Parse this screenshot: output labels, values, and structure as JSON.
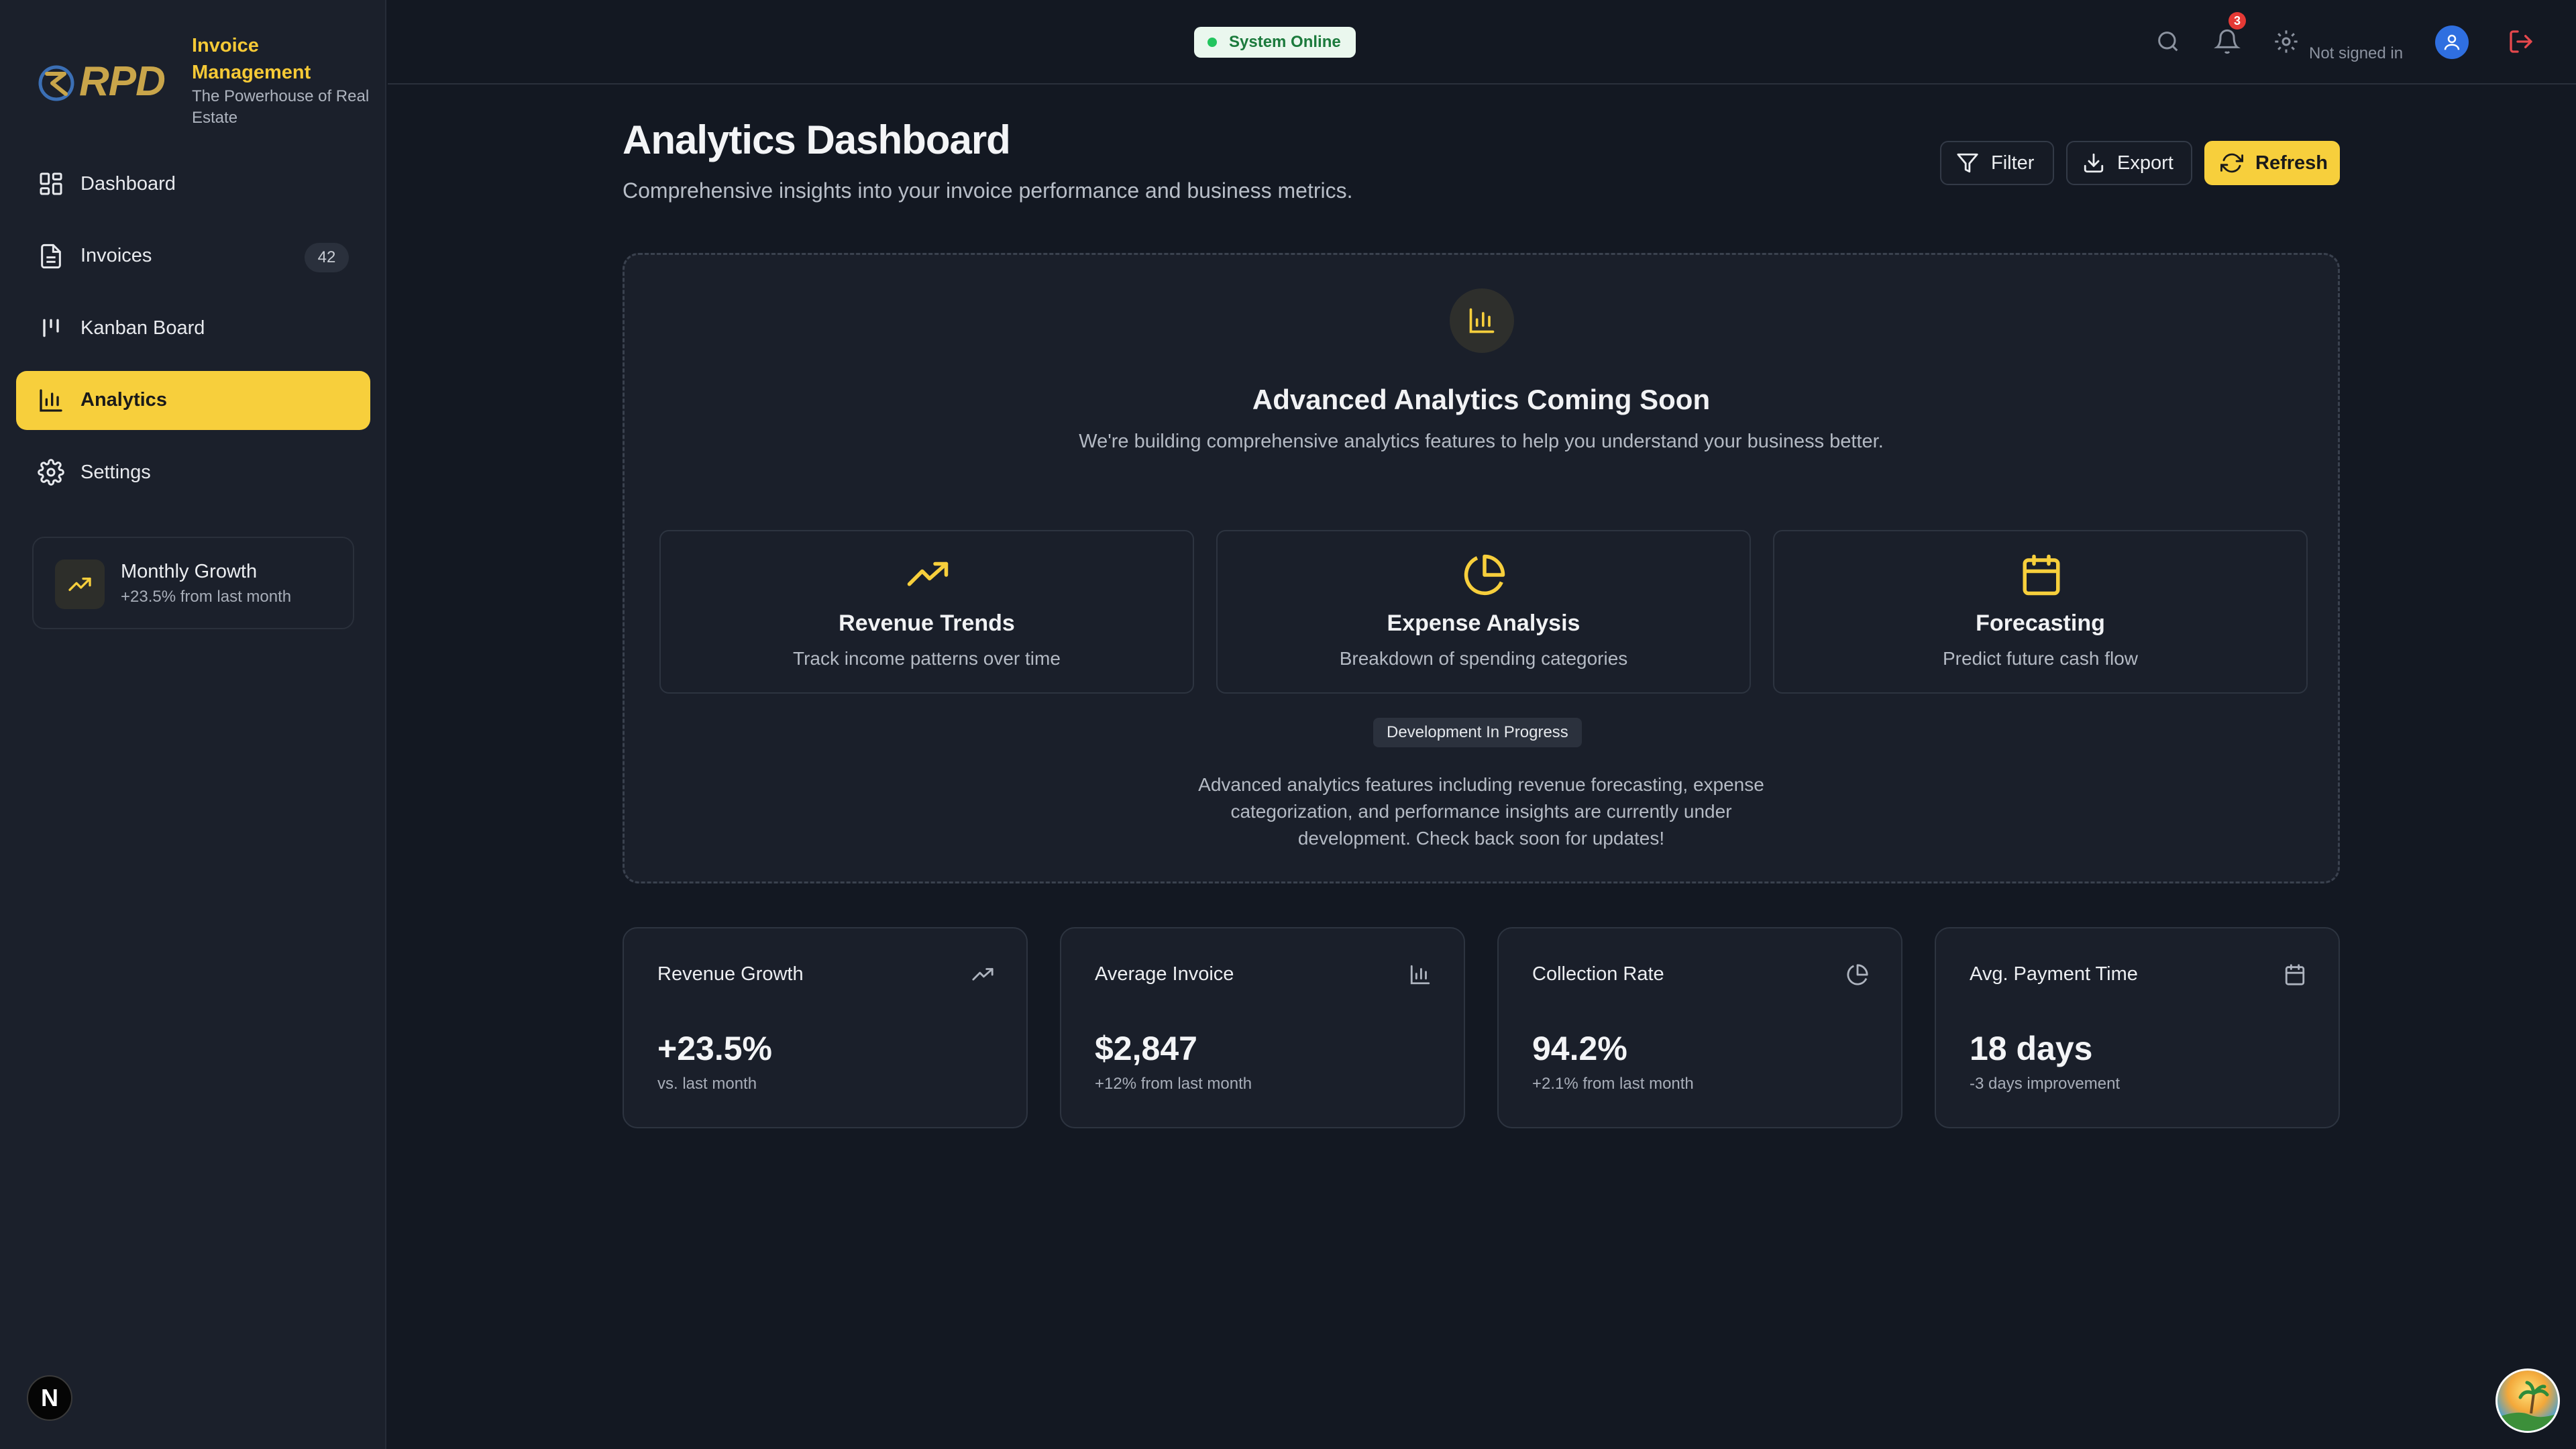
{
  "brand": {
    "logo_text": "RPD",
    "title": "Invoice Management",
    "subtitle": "The Powerhouse of Real Estate"
  },
  "nav": [
    {
      "label": "Dashboard",
      "icon": "dashboard-grid-icon",
      "active": false
    },
    {
      "label": "Invoices",
      "icon": "file-text-icon",
      "badge": "42",
      "active": false
    },
    {
      "label": "Kanban Board",
      "icon": "kanban-icon",
      "active": false
    },
    {
      "label": "Analytics",
      "icon": "bar-chart-icon",
      "active": true
    },
    {
      "label": "Settings",
      "icon": "gear-icon",
      "active": false
    }
  ],
  "growth_card": {
    "title": "Monthly Growth",
    "subtitle": "+23.5% from last month",
    "icon": "trending-up-icon"
  },
  "header": {
    "status": "System Online",
    "notification_count": "3",
    "user_status": "Not signed in"
  },
  "page": {
    "title": "Analytics Dashboard",
    "subtitle": "Comprehensive insights into your invoice performance and business metrics."
  },
  "actions": {
    "filter": "Filter",
    "export": "Export",
    "refresh": "Refresh"
  },
  "coming_soon": {
    "title": "Advanced Analytics Coming Soon",
    "subtitle": "We're building comprehensive analytics features to help you understand your business better.",
    "features": [
      {
        "title": "Revenue Trends",
        "desc": "Track income patterns over time",
        "icon": "trending-up-icon"
      },
      {
        "title": "Expense Analysis",
        "desc": "Breakdown of spending categories",
        "icon": "pie-chart-icon"
      },
      {
        "title": "Forecasting",
        "desc": "Predict future cash flow",
        "icon": "calendar-icon"
      }
    ],
    "dev_pill": "Development In Progress",
    "note_lines": [
      "Advanced analytics features including revenue forecasting, expense",
      "categorization, and performance insights are currently under",
      "development. Check back soon for updates!"
    ]
  },
  "stats": [
    {
      "title": "Revenue Growth",
      "value": "+23.5%",
      "sub": "vs. last month",
      "icon": "trending-up-icon"
    },
    {
      "title": "Average Invoice",
      "value": "$2,847",
      "sub": "+12% from last month",
      "icon": "bar-chart-icon"
    },
    {
      "title": "Collection Rate",
      "value": "94.2%",
      "sub": "+2.1% from last month",
      "icon": "pie-chart-icon"
    },
    {
      "title": "Avg. Payment Time",
      "value": "18 days",
      "sub": "-3 days improvement",
      "icon": "calendar-icon"
    }
  ],
  "colors": {
    "accent": "#f7cf3c",
    "background": "#131822",
    "sidebar": "#1b202b",
    "status_green": "#22c55e",
    "danger": "#e53935"
  }
}
